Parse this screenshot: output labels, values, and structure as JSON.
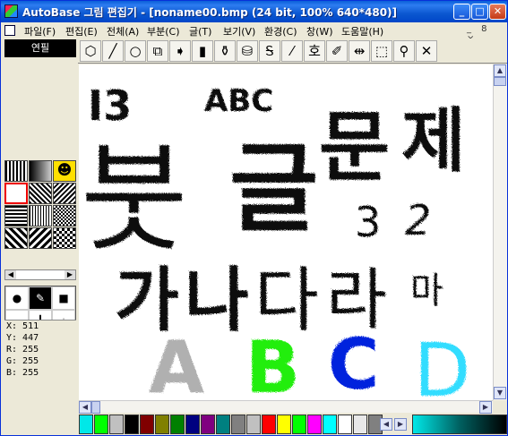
{
  "window": {
    "title": "AutoBase 그림 편집기 - [noname00.bmp (24 bit, 100% 640*480)]",
    "buttons": {
      "minimize": "_",
      "maximize": "□",
      "close": "✕"
    }
  },
  "menu": {
    "items": [
      "파일(F)",
      "편집(E)",
      "전체(A)",
      "부분(C)",
      "글(T)",
      "보기(V)",
      "환경(C)",
      "창(W)",
      "도움말(H)"
    ],
    "mdi_controls": "_ 8 ×"
  },
  "left_panel": {
    "tool_title": "연필",
    "coords": {
      "x": "X: 511",
      "y": "Y: 447",
      "r": "R: 255",
      "g": "G: 255",
      "b": "B: 255"
    }
  },
  "toolbar": {
    "icons": [
      "eraser-3d-icon",
      "line-icon",
      "ellipse-icon",
      "rectangle-icon",
      "fill-arrow-icon",
      "paint-bottle-icon",
      "spray-icon",
      "bucket-icon",
      "curve-icon",
      "eyedropper-icon",
      "text-icon",
      "brush-icon",
      "resize-icon",
      "selection-icon",
      "magnifier-icon",
      "cancel-icon"
    ]
  },
  "canvas": {
    "drawings": [
      {
        "text": "I3",
        "color": "#111111"
      },
      {
        "text": "ABC",
        "color": "#111111"
      },
      {
        "text": "문",
        "color": "#111111"
      },
      {
        "text": "제",
        "color": "#111111"
      },
      {
        "text": "붓",
        "color": "#111111"
      },
      {
        "text": "글",
        "color": "#111111"
      },
      {
        "text": "3",
        "color": "#111111"
      },
      {
        "text": "2",
        "color": "#111111"
      },
      {
        "text": "가",
        "color": "#111111"
      },
      {
        "text": "나",
        "color": "#111111"
      },
      {
        "text": "다",
        "color": "#111111"
      },
      {
        "text": "라",
        "color": "#111111"
      },
      {
        "text": "마",
        "color": "#111111"
      },
      {
        "text": "A",
        "color": "#b0b0b0"
      },
      {
        "text": "B",
        "color": "#22ee11"
      },
      {
        "text": "C",
        "color": "#0022dd"
      },
      {
        "text": "D",
        "color": "#33ddff"
      }
    ]
  },
  "palette": {
    "colors": [
      "#00e8e8",
      "#00ff00",
      "#c0c0c0",
      "#000000",
      "#800000",
      "#808000",
      "#008000",
      "#000080",
      "#800080",
      "#008080",
      "#808080",
      "#c0c0c0",
      "#ff0000",
      "#ffff00",
      "#00ff00",
      "#ff00ff",
      "#00ffff",
      "#ffffff",
      "#e8e8e8",
      "#808080"
    ]
  }
}
